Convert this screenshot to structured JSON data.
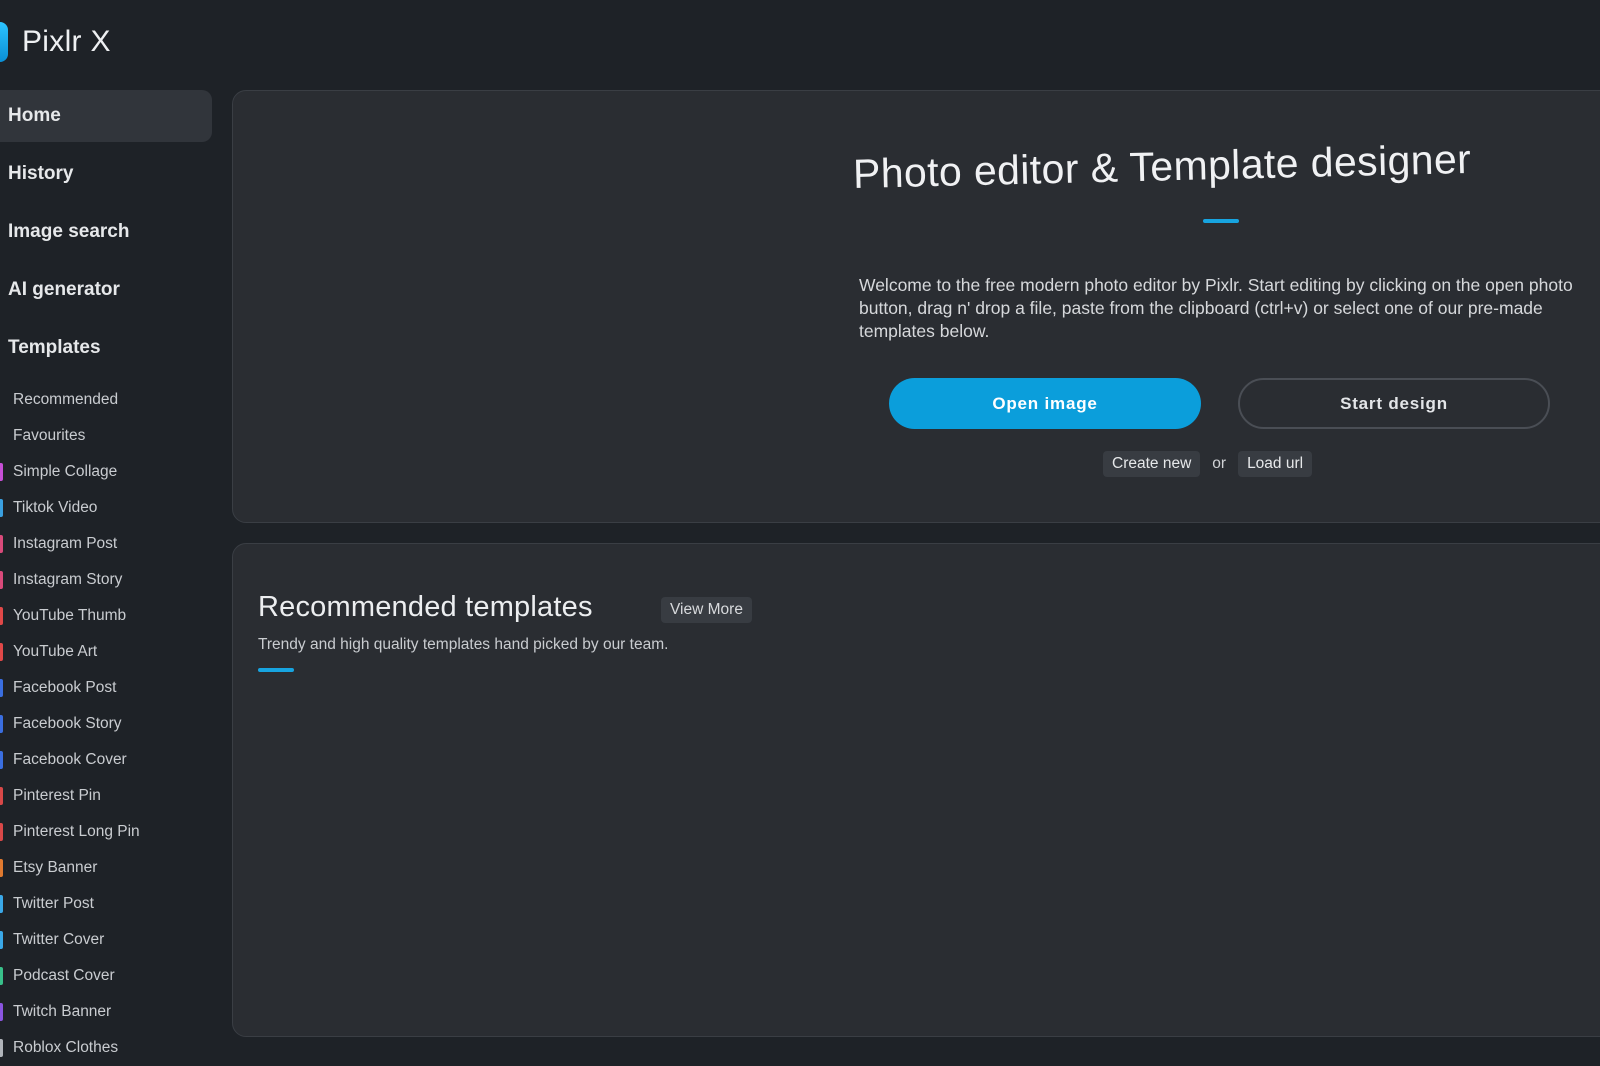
{
  "app": {
    "name": "Pixlr X"
  },
  "colors": {
    "accent": "#0b9edb",
    "background": "#1e2227",
    "card": "#2a2d32"
  },
  "sidebar": {
    "nav": [
      {
        "label": "Home",
        "active": true
      },
      {
        "label": "History"
      },
      {
        "label": "Image search"
      },
      {
        "label": "AI generator"
      },
      {
        "label": "Templates"
      }
    ],
    "templates": [
      {
        "label": "Recommended",
        "color": ""
      },
      {
        "label": "Favourites",
        "color": ""
      },
      {
        "label": "Simple Collage",
        "color": "#c64fd6"
      },
      {
        "label": "Tiktok Video",
        "color": "#3aa0e0"
      },
      {
        "label": "Instagram Post",
        "color": "#d94a7a"
      },
      {
        "label": "Instagram Story",
        "color": "#d94a7a"
      },
      {
        "label": "YouTube Thumb",
        "color": "#e04848"
      },
      {
        "label": "YouTube Art",
        "color": "#e04848"
      },
      {
        "label": "Facebook Post",
        "color": "#3a6ee0"
      },
      {
        "label": "Facebook Story",
        "color": "#3a6ee0"
      },
      {
        "label": "Facebook Cover",
        "color": "#3a6ee0"
      },
      {
        "label": "Pinterest Pin",
        "color": "#d84848"
      },
      {
        "label": "Pinterest Long Pin",
        "color": "#d84848"
      },
      {
        "label": "Etsy Banner",
        "color": "#e07a30"
      },
      {
        "label": "Twitter Post",
        "color": "#3aa8e8"
      },
      {
        "label": "Twitter Cover",
        "color": "#3aa8e8"
      },
      {
        "label": "Podcast Cover",
        "color": "#38c08a"
      },
      {
        "label": "Twitch Banner",
        "color": "#8a55e0"
      },
      {
        "label": "Roblox Clothes",
        "color": "#b0b4ba"
      }
    ]
  },
  "hero": {
    "title": "Photo editor & Template designer",
    "description": "Welcome to the free modern photo editor by Pixlr. Start editing by clicking on the open photo button, drag n' drop a file, paste from the clipboard (ctrl+v) or select one of our pre-made templates below.",
    "open_image": "Open image",
    "start_design": "Start design",
    "create_new": "Create new",
    "or": "or",
    "load_url": "Load url"
  },
  "recommended": {
    "title": "Recommended templates",
    "view_more": "View More",
    "description": "Trendy and high quality templates hand picked by our team."
  }
}
